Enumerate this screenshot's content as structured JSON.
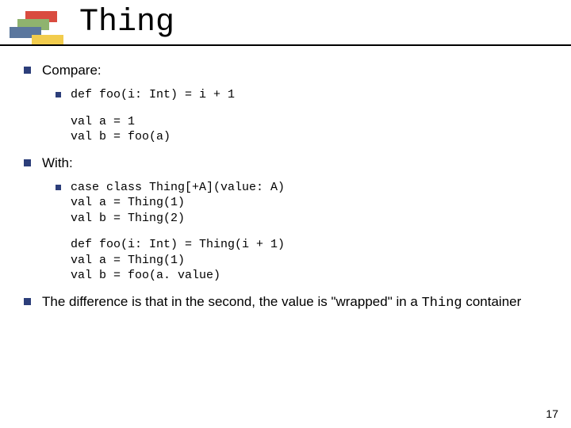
{
  "title": "Thing",
  "sections": {
    "compare": {
      "label": "Compare:",
      "code1": "def foo(i: Int) = i + 1",
      "code2": "val a = 1\nval b = foo(a)"
    },
    "with": {
      "label": "With:",
      "code1": "case class Thing[+A](value: A)\nval a = Thing(1)\nval b = Thing(2)",
      "code2": "def foo(i: Int) = Thing(i + 1)\nval a = Thing(1)\nval b = foo(a. value)"
    },
    "conclusion": {
      "pre": "The difference is that in the second, the value is \"wrapped\" in a ",
      "code": "Thing",
      "post": " container"
    }
  },
  "page_number": "17"
}
